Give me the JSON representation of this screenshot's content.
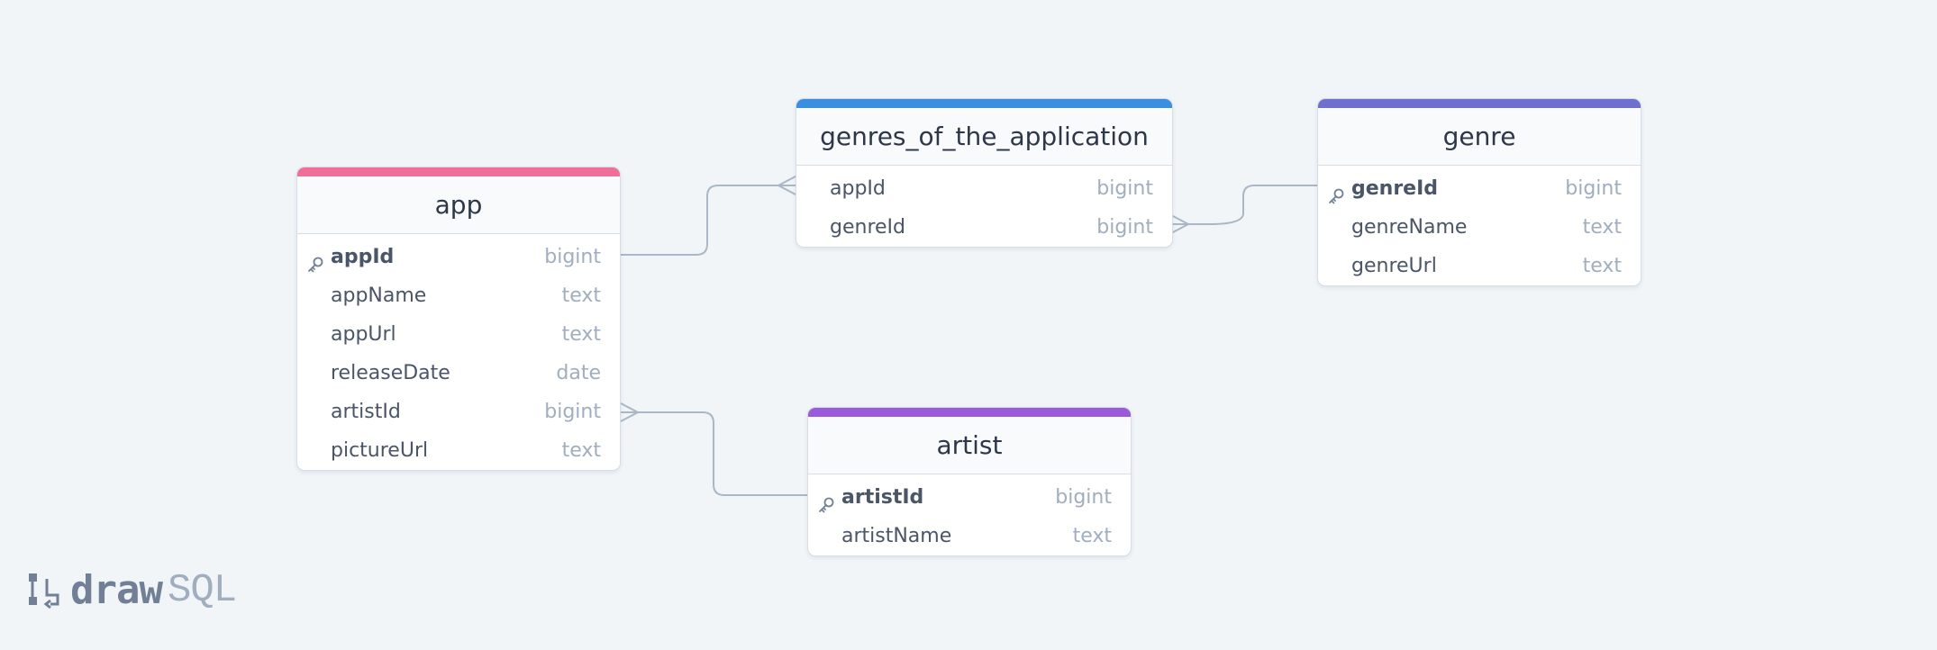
{
  "brand": {
    "logo_name": "draw",
    "logo_suffix": "SQL"
  },
  "colors": {
    "app": "#f06e98",
    "genres_of_the_application": "#3b8fe0",
    "genre": "#6f6fcf",
    "artist": "#9b59db",
    "connector": "#a9b7c6"
  },
  "tables": {
    "app": {
      "name": "app",
      "columns": [
        {
          "name": "appId",
          "type": "bigint",
          "primary_key": true
        },
        {
          "name": "appName",
          "type": "text",
          "primary_key": false
        },
        {
          "name": "appUrl",
          "type": "text",
          "primary_key": false
        },
        {
          "name": "releaseDate",
          "type": "date",
          "primary_key": false
        },
        {
          "name": "artistId",
          "type": "bigint",
          "primary_key": false
        },
        {
          "name": "pictureUrl",
          "type": "text",
          "primary_key": false
        }
      ]
    },
    "genres_of_the_application": {
      "name": "genres_of_the_application",
      "columns": [
        {
          "name": "appId",
          "type": "bigint",
          "primary_key": false
        },
        {
          "name": "genreId",
          "type": "bigint",
          "primary_key": false
        }
      ]
    },
    "genre": {
      "name": "genre",
      "columns": [
        {
          "name": "genreId",
          "type": "bigint",
          "primary_key": true
        },
        {
          "name": "genreName",
          "type": "text",
          "primary_key": false
        },
        {
          "name": "genreUrl",
          "type": "text",
          "primary_key": false
        }
      ]
    },
    "artist": {
      "name": "artist",
      "columns": [
        {
          "name": "artistId",
          "type": "bigint",
          "primary_key": true
        },
        {
          "name": "artistName",
          "type": "text",
          "primary_key": false
        }
      ]
    }
  },
  "relationships": [
    {
      "from_table": "app",
      "from_column": "appId",
      "to_table": "genres_of_the_application",
      "to_column": "appId",
      "cardinality": "one-to-many"
    },
    {
      "from_table": "genre",
      "from_column": "genreId",
      "to_table": "genres_of_the_application",
      "to_column": "genreId",
      "cardinality": "one-to-many"
    },
    {
      "from_table": "artist",
      "from_column": "artistId",
      "to_table": "app",
      "to_column": "artistId",
      "cardinality": "one-to-many"
    }
  ]
}
